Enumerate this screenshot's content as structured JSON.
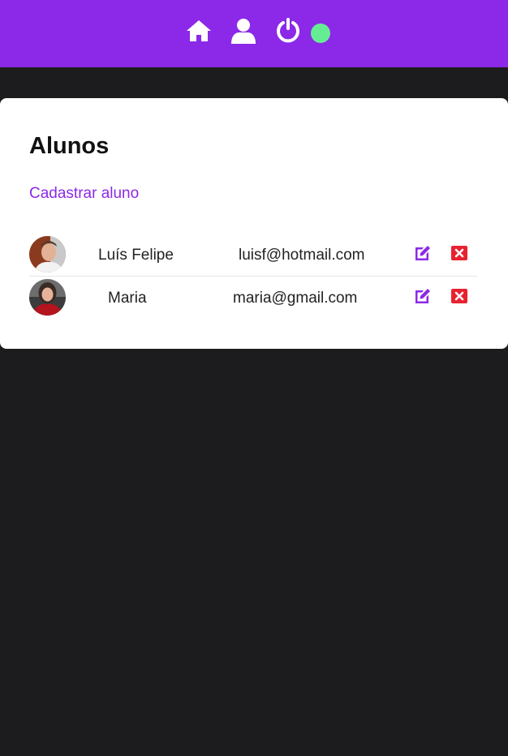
{
  "navbar": {
    "icons": [
      "home-icon",
      "user-icon",
      "power-icon"
    ],
    "status": "online",
    "colors": {
      "background": "#8c29e8",
      "status": "#66ed94"
    }
  },
  "page": {
    "title": "Alunos",
    "create_link": "Cadastrar aluno"
  },
  "students": [
    {
      "name": "Luís Felipe",
      "email": "luisf@hotmail.com"
    },
    {
      "name": "Maria",
      "email": "maria@gmail.com"
    }
  ],
  "actions": {
    "edit_icon": "edit-icon",
    "delete_icon": "delete-icon"
  },
  "colors": {
    "accent": "#8c29e8",
    "delete": "#e8222f",
    "background": "#1c1c1e"
  }
}
